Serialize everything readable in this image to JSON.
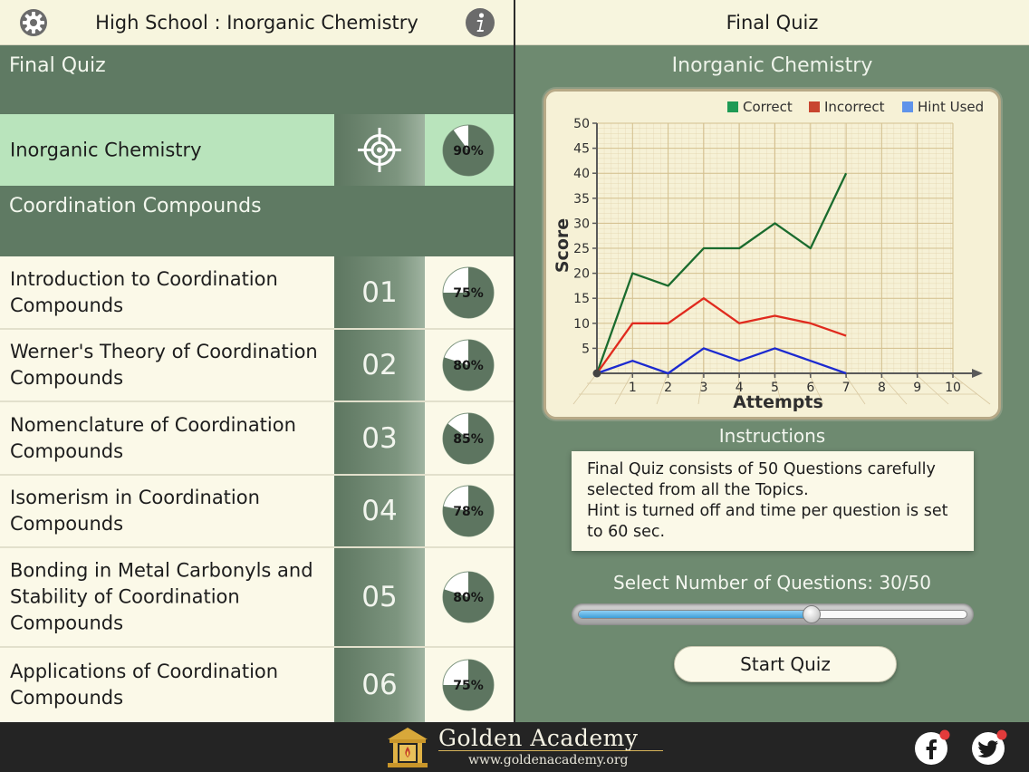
{
  "left_header": {
    "title": "High School : Inorganic Chemistry",
    "settings_icon": "gear-icon",
    "info_icon": "info-icon"
  },
  "final_quiz_section": {
    "label": "Final Quiz"
  },
  "topic_row": {
    "label": "Inorganic Chemistry",
    "icon": "target-icon",
    "progress_pct": 90,
    "progress_label": "90%"
  },
  "chapter_section": {
    "label": "Coordination Compounds"
  },
  "chapters": [
    {
      "label": "Introduction to Coordination Compounds",
      "number": "01",
      "progress_pct": 75,
      "progress_label": "75%"
    },
    {
      "label": "Werner's Theory of Coordination Compounds",
      "number": "02",
      "progress_pct": 80,
      "progress_label": "80%"
    },
    {
      "label": "Nomenclature of Coordination Compounds",
      "number": "03",
      "progress_pct": 85,
      "progress_label": "85%"
    },
    {
      "label": "Isomerism in Coordination Compounds",
      "number": "04",
      "progress_pct": 78,
      "progress_label": "78%"
    },
    {
      "label": "Bonding in Metal Carbonyls and Stability of Coordination Compounds",
      "number": "05",
      "progress_pct": 80,
      "progress_label": "80%"
    },
    {
      "label": "Applications of Coordination Compounds",
      "number": "06",
      "progress_pct": 75,
      "progress_label": "75%"
    }
  ],
  "right_header": {
    "title": "Final Quiz"
  },
  "chart_data": {
    "type": "line",
    "title": "Inorganic Chemistry",
    "xlabel": "Attempts",
    "ylabel": "Score",
    "x": [
      0,
      1,
      2,
      3,
      4,
      5,
      6,
      7
    ],
    "xticks": [
      1,
      2,
      3,
      4,
      5,
      6,
      7,
      8,
      9,
      10
    ],
    "yticks": [
      5,
      10,
      15,
      20,
      25,
      30,
      35,
      40,
      45,
      50
    ],
    "xlim": [
      0,
      10
    ],
    "ylim": [
      0,
      50
    ],
    "grid": true,
    "legend_position": "top-right",
    "series": [
      {
        "name": "Correct",
        "color": "#1a6b2e",
        "legend_color": "#1e9a55",
        "values": [
          0,
          20,
          17.5,
          25,
          25,
          30,
          25,
          40
        ]
      },
      {
        "name": "Incorrect",
        "color": "#e02a1e",
        "legend_color": "#c8452f",
        "values": [
          0,
          10,
          10,
          15,
          10,
          11.5,
          10,
          7.5
        ]
      },
      {
        "name": "Hint Used",
        "color": "#1c2ad0",
        "legend_color": "#5f93ea",
        "values": [
          0,
          2.5,
          0,
          5,
          2.5,
          5,
          2.5,
          0
        ]
      }
    ]
  },
  "instructions": {
    "title": "Instructions",
    "line1": "Final Quiz consists of 50 Questions carefully selected from all the Topics.",
    "line2": "Hint is turned off and time per question is set to 60 sec."
  },
  "question_selector": {
    "label": "Select Number of Questions: 30/50",
    "value": 30,
    "max": 50
  },
  "start_button": {
    "label": "Start Quiz"
  },
  "footer": {
    "brand": "Golden Academy",
    "url": "www.goldenacademy.org",
    "logo_icon": "academy-logo-icon",
    "facebook_icon": "facebook-icon",
    "twitter_icon": "twitter-icon"
  },
  "colors": {
    "panel_green": "#6e8a70",
    "section_green": "#5f7a63",
    "selected_row": "#b9e4bc",
    "cream": "#fbf9e8"
  }
}
